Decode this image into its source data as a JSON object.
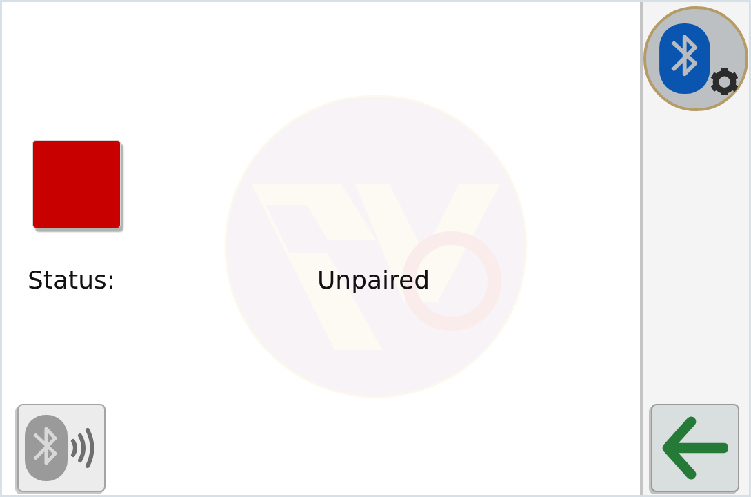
{
  "indicator": {
    "color": "#c80000"
  },
  "status": {
    "label": "Status:",
    "value": "Unpaired"
  },
  "buttons": [
    {
      "kind": "settings",
      "disabled": false
    },
    {
      "kind": "pair",
      "disabled": true
    },
    {
      "kind": "back",
      "disabled": false
    }
  ]
}
